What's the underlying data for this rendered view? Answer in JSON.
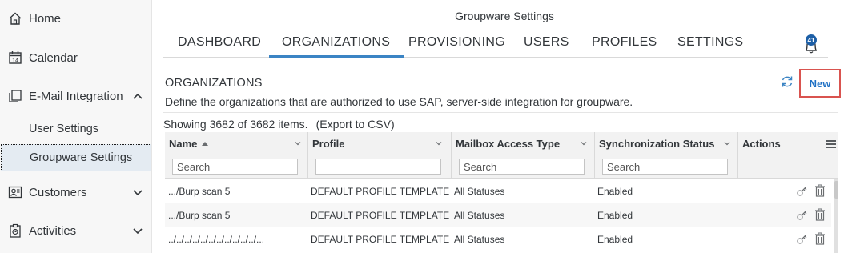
{
  "app_title": "Groupware Settings",
  "sidebar": {
    "items": [
      {
        "label": "Home",
        "icon": "home-icon"
      },
      {
        "label": "Calendar",
        "icon": "calendar-icon",
        "icon_text": "14"
      },
      {
        "label": "E-Mail Integration",
        "icon": "email-integration-icon",
        "expanded": true
      },
      {
        "label": "Customers",
        "icon": "customers-icon"
      },
      {
        "label": "Activities",
        "icon": "activities-icon"
      }
    ],
    "subitems": [
      {
        "label": "User Settings"
      },
      {
        "label": "Groupware Settings",
        "selected": true
      }
    ]
  },
  "tabs": [
    {
      "label": "DASHBOARD"
    },
    {
      "label": "ORGANIZATIONS",
      "active": true
    },
    {
      "label": "PROVISIONING"
    },
    {
      "label": "USERS"
    },
    {
      "label": "PROFILES"
    },
    {
      "label": "SETTINGS"
    }
  ],
  "notifications": {
    "count": "41"
  },
  "section": {
    "title": "ORGANIZATIONS",
    "description": "Define the organizations that are authorized to use SAP, server-side integration for groupware.",
    "new_label": "New"
  },
  "showing": {
    "text": "Showing 3682 of 3682 items.",
    "export": "(Export to CSV)"
  },
  "table": {
    "columns": [
      {
        "label": "Name",
        "placeholder": "Search",
        "sort": "ascending"
      },
      {
        "label": "Profile",
        "placeholder": ""
      },
      {
        "label": "Mailbox Access Type",
        "placeholder": "Search"
      },
      {
        "label": "Synchronization Status",
        "placeholder": "Search"
      },
      {
        "label": "Actions"
      }
    ],
    "rows": [
      {
        "name": ".../Burp scan 5",
        "profile": "DEFAULT PROFILE TEMPLATE",
        "access": "All Statuses",
        "status": "Enabled"
      },
      {
        "name": ".../Burp scan 5",
        "profile": "DEFAULT PROFILE TEMPLATE",
        "access": "All Statuses",
        "status": "Enabled"
      },
      {
        "name": "../../../../../../../../../../../...",
        "profile": "DEFAULT PROFILE TEMPLATE",
        "access": "All Statuses",
        "status": "Enabled"
      }
    ]
  },
  "colors": {
    "accent": "#3b84c4",
    "new_border": "#d9534f",
    "badge": "#1d5fa6",
    "selected_bg": "#e4ebf2"
  }
}
